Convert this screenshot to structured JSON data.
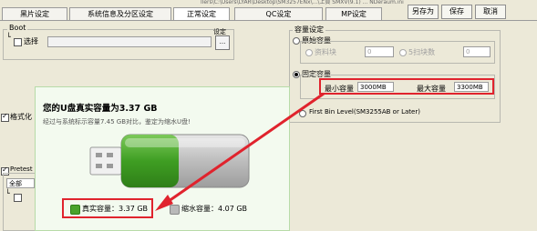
{
  "title_bar": {
    "path": "llers\\C:\\Users\\LYAR\\Desktop\\SM3257ENx\\...\\上頁    SMXV(9.1) ... NDeraum.ini"
  },
  "tabs": [
    {
      "label": "黑片设定"
    },
    {
      "label": "系统信息及分区设定"
    },
    {
      "label": "正常设定"
    },
    {
      "label": "QC设定"
    },
    {
      "label": "MP设定"
    }
  ],
  "toolbar": {
    "save_as": "另存为",
    "save": "保存",
    "cancel": "取消"
  },
  "boot": {
    "group": "Boot",
    "select_label": "选择",
    "browse_label": "设定"
  },
  "left_checks": {
    "format": "格式化",
    "pretest": "Pretest",
    "all_label": "全部"
  },
  "capacity": {
    "group": "容量设定",
    "original_label": "原始容量",
    "resource_label": "资料块",
    "resource_value": "0",
    "fast_label": "5扫块数",
    "fast_value": "0",
    "fixed_label": "固定容量",
    "min_label": "最小容量",
    "min_value": "3000MB",
    "max_label": "最大容量",
    "max_value": "3300MB",
    "first_bin": "First Bin Level(SM3255AB or Later)"
  },
  "popup": {
    "title": "您的U盘真实容量为3.37 GB",
    "subtitle": "经过与系统标示容量7.45 GB对比，鉴定为缩水U盘!",
    "real_label": "真实容量：3.37 GB",
    "shrink_label": "缩水容量：4.07 GB",
    "fill_fraction": 0.45
  },
  "colors": {
    "highlight": "#e0232d",
    "drive_green": "#4aa32b",
    "drive_gray": "#b9b9b9"
  }
}
